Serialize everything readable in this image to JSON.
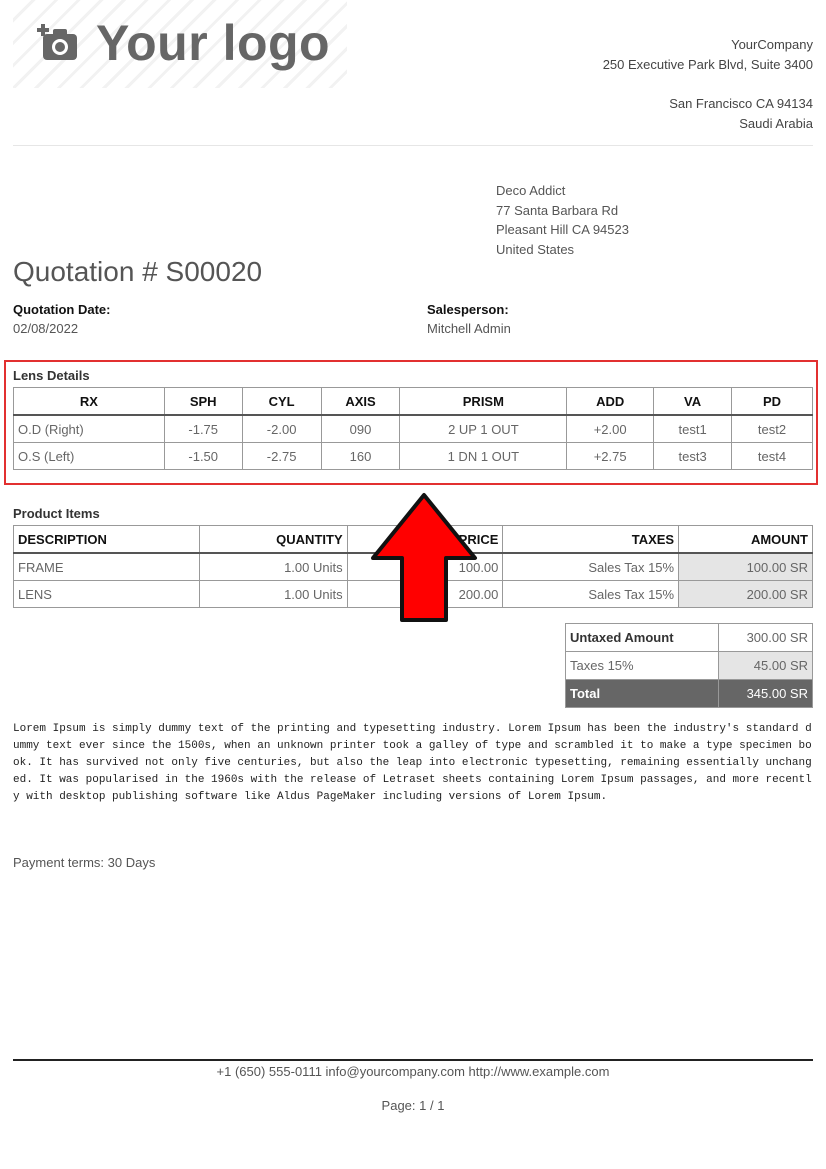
{
  "logo": {
    "text": "Your logo",
    "icon": "camera-add-icon"
  },
  "company": {
    "name": "YourCompany",
    "street": "250 Executive Park Blvd, Suite 3400",
    "city": "San Francisco CA 94134",
    "country": "Saudi Arabia"
  },
  "customer": {
    "name": "Deco Addict",
    "street": "77 Santa Barbara Rd",
    "city": "Pleasant Hill CA 94523",
    "country": "United States"
  },
  "title": "Quotation # S00020",
  "quotation_date": {
    "label": "Quotation Date:",
    "value": "02/08/2022"
  },
  "salesperson": {
    "label": "Salesperson:",
    "value": "Mitchell Admin"
  },
  "lens": {
    "label": "Lens Details",
    "headers": [
      "RX",
      "SPH",
      "CYL",
      "AXIS",
      "PRISM",
      "ADD",
      "VA",
      "PD"
    ],
    "rows": [
      [
        "O.D (Right)",
        "-1.75",
        "-2.00",
        "090",
        "2 UP 1 OUT",
        "+2.00",
        "test1",
        "test2"
      ],
      [
        "O.S (Left)",
        "-1.50",
        "-2.75",
        "160",
        "1 DN 1 OUT",
        "+2.75",
        "test3",
        "test4"
      ]
    ]
  },
  "products": {
    "label": "Product Items",
    "headers": [
      "DESCRIPTION",
      "QUANTITY",
      "UNIT PRICE",
      "TAXES",
      "AMOUNT"
    ],
    "rows": [
      [
        "FRAME",
        "1.00 Units",
        "100.00",
        "Sales Tax 15%",
        "100.00 SR"
      ],
      [
        "LENS",
        "1.00 Units",
        "200.00",
        "Sales Tax 15%",
        "200.00 SR"
      ]
    ]
  },
  "totals": {
    "untaxed_label": "Untaxed Amount",
    "untaxed_value": "300.00 SR",
    "taxes_label": "Taxes 15%",
    "taxes_value": "45.00 SR",
    "total_label": "Total",
    "total_value": "345.00 SR"
  },
  "lorem": "Lorem Ipsum is simply dummy text of the printing and typesetting industry. Lorem Ipsum has been the industry's standard dummy text ever since the 1500s, when an unknown printer took a galley of type and scrambled it to make a type specimen book. It has survived not only five centuries, but also the leap into electronic typesetting, remaining essentially unchanged. It was popularised in the 1960s with the release of Letraset sheets containing Lorem Ipsum passages, and more recently with desktop publishing software like Aldus PageMaker including versions of Lorem Ipsum.",
  "payment_terms": "Payment terms: 30 Days",
  "footer": "+1 (650) 555-0111 info@yourcompany.com http://www.example.com",
  "page_label": "Page: 1 / 1",
  "colors": {
    "highlight_box": "#e23030",
    "arrow_fill": "#ff0000",
    "total_row": "#666666"
  }
}
